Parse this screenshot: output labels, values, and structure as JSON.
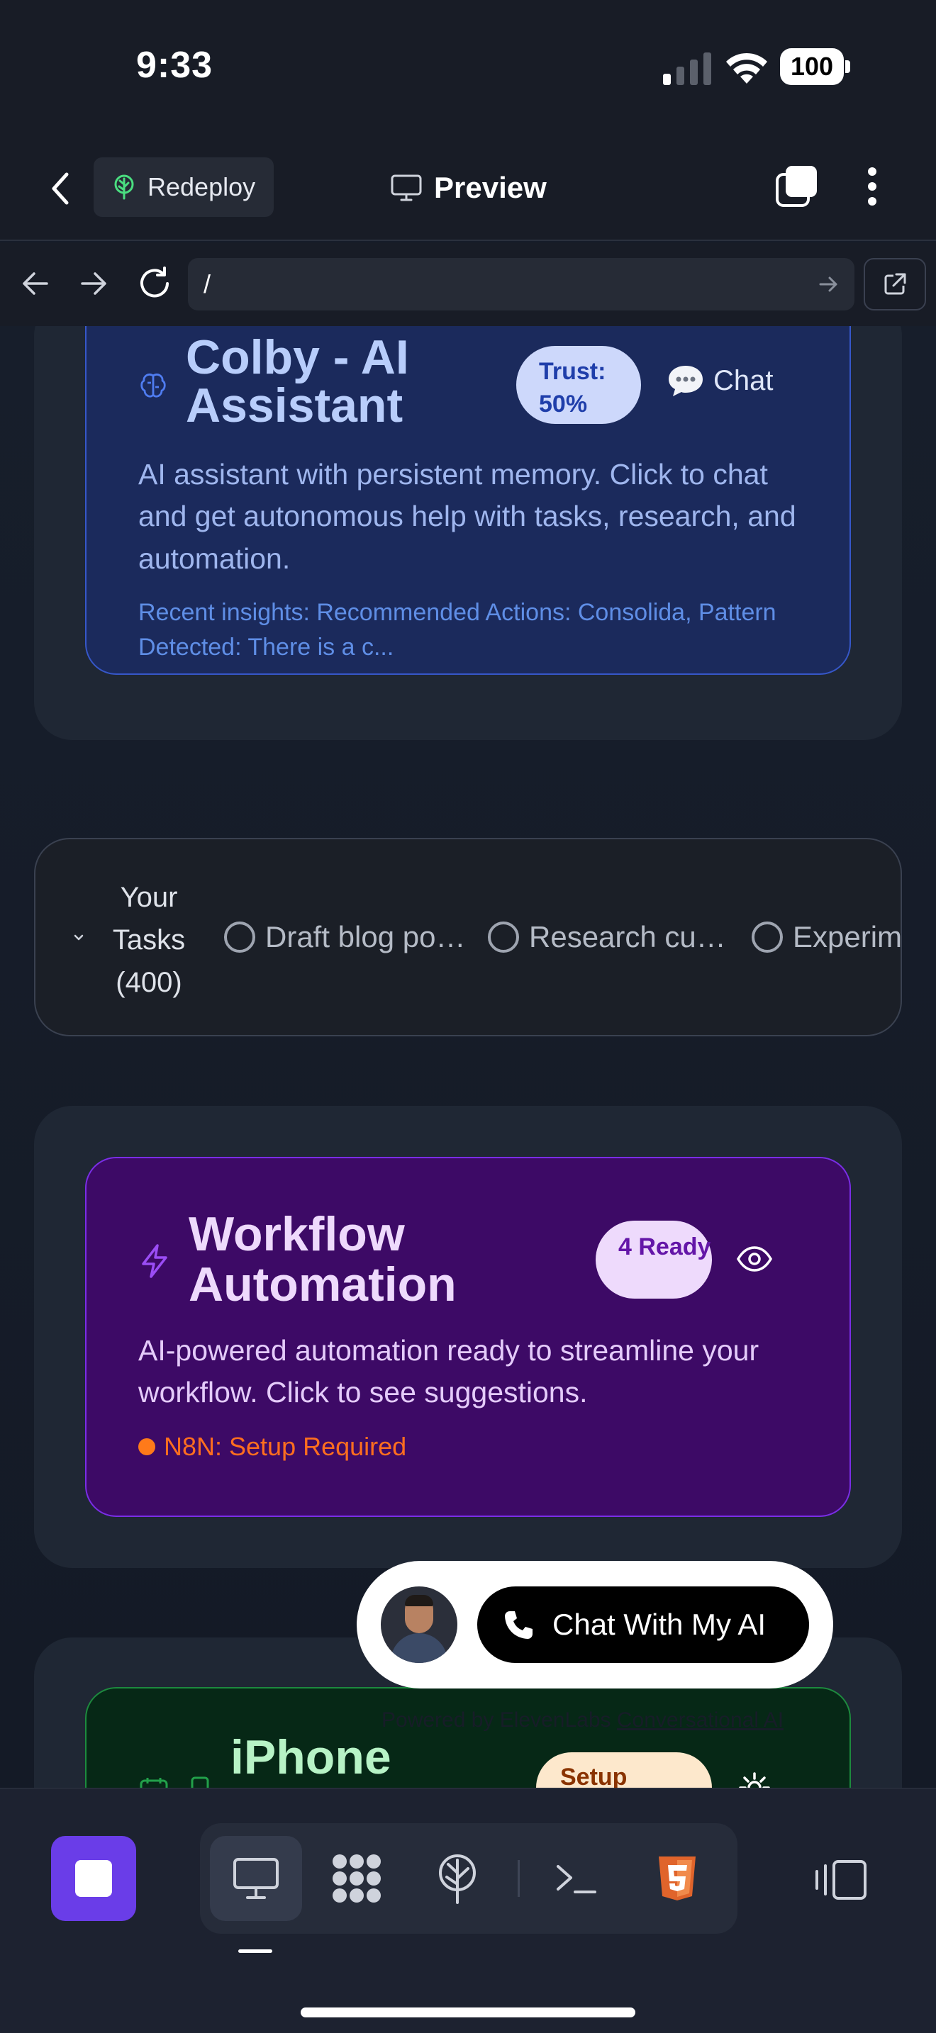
{
  "status_bar": {
    "time": "9:33",
    "battery": "100"
  },
  "header": {
    "redeploy_label": "Redeploy",
    "title": "Preview"
  },
  "url_bar": {
    "value": "/"
  },
  "colby_card": {
    "title": "Colby - AI Assistant",
    "trust_badge": "Trust: 50%",
    "chat_label": "Chat",
    "description": "AI assistant with persistent memory. Click to chat and get autonomous help with tasks, research, and automation.",
    "insights": "Recent insights: Recommended Actions: Consolida, Pattern Detected: There is a c..."
  },
  "tasks": {
    "label": "Your Tasks (400)",
    "items": [
      "Draft blog po…",
      "Research cu…",
      "Experimen"
    ]
  },
  "workflow_card": {
    "title": "Workflow Automation",
    "ready_badge": "4 Ready",
    "description": "AI-powered automation ready to streamline your workflow. Click to see suggestions.",
    "status": "N8N: Setup Required",
    "status_color": "#ff6e1f"
  },
  "iphone_card": {
    "title": "iPhone",
    "setup_badge": "Setup"
  },
  "voice_widget": {
    "button_label": "Chat With My AI",
    "powered_by": "Powered by ElevenLabs",
    "powered_link": "Conversational AI"
  },
  "toolbar": {
    "tools": [
      "desktop-icon",
      "apps-icon",
      "deploy-icon",
      "terminal-icon",
      "html5-icon"
    ],
    "accent": "#6a3de8"
  }
}
